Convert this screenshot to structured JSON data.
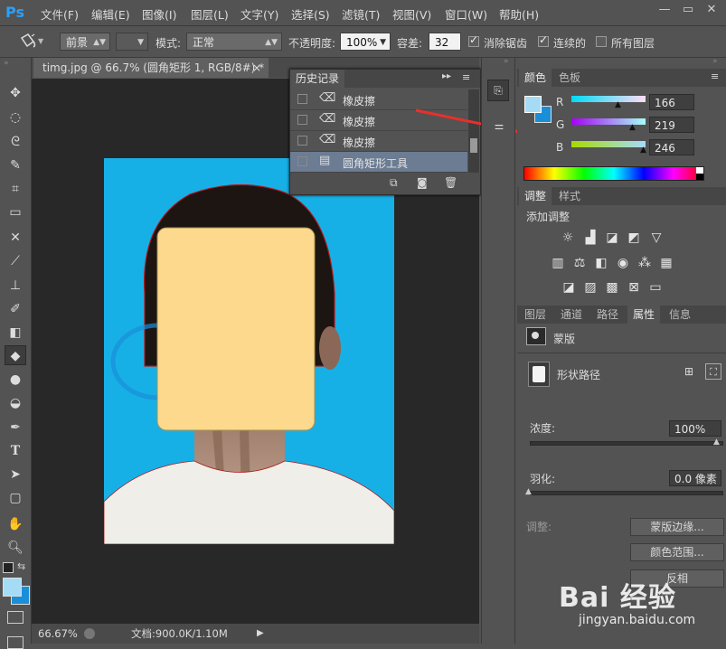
{
  "app": {
    "logo": "Ps"
  },
  "menu": [
    "文件(F)",
    "编辑(E)",
    "图像(I)",
    "图层(L)",
    "文字(Y)",
    "选择(S)",
    "滤镜(T)",
    "视图(V)",
    "窗口(W)",
    "帮助(H)"
  ],
  "window_controls": {
    "minimize": "—",
    "restore": "▭",
    "close": "✕"
  },
  "options": {
    "fill_source": "前景",
    "mode_label": "模式:",
    "mode_value": "正常",
    "opacity_label": "不透明度:",
    "opacity_value": "100%",
    "tolerance_label": "容差:",
    "tolerance_value": "32",
    "antialias_label": "消除锯齿",
    "contiguous_label": "连续的",
    "all_layers_label": "所有图层"
  },
  "document": {
    "tab_title": "timg.jpg @ 66.7% (圆角矩形 1, RGB/8#) *",
    "tab_close": "×",
    "zoom": "66.67%",
    "doc_info": "文档:900.0K/1.10M"
  },
  "history": {
    "title": "历史记录",
    "items": [
      {
        "label": "橡皮擦",
        "icon": "eraser-icon"
      },
      {
        "label": "橡皮擦",
        "icon": "eraser-icon"
      },
      {
        "label": "橡皮擦",
        "icon": "eraser-icon"
      },
      {
        "label": "圆角矩形工具",
        "icon": "document-icon"
      }
    ]
  },
  "color_panel": {
    "tabs": [
      "颜色",
      "色板"
    ],
    "r_label": "R",
    "g_label": "G",
    "b_label": "B",
    "r": "166",
    "g": "219",
    "b": "246",
    "foreground": "#a6dbf6",
    "background": "#1a8fd8"
  },
  "adjust_panel": {
    "tabs": [
      "调整",
      "样式"
    ],
    "heading": "添加调整"
  },
  "props_panel": {
    "tabs": [
      "图层",
      "通道",
      "路径",
      "属性",
      "信息"
    ],
    "mask_label": "蒙版",
    "shape_label": "形状路径",
    "density_label": "浓度:",
    "density_value": "100%",
    "feather_label": "羽化:",
    "feather_value": "0.0 像素",
    "refine_label": "调整:",
    "mask_edge_btn": "蒙版边缘...",
    "color_range_btn": "颜色范围...",
    "invert_btn": "反相"
  },
  "watermark": {
    "brand": "Bai 经验",
    "url": "jingyan.baidu.com"
  }
}
